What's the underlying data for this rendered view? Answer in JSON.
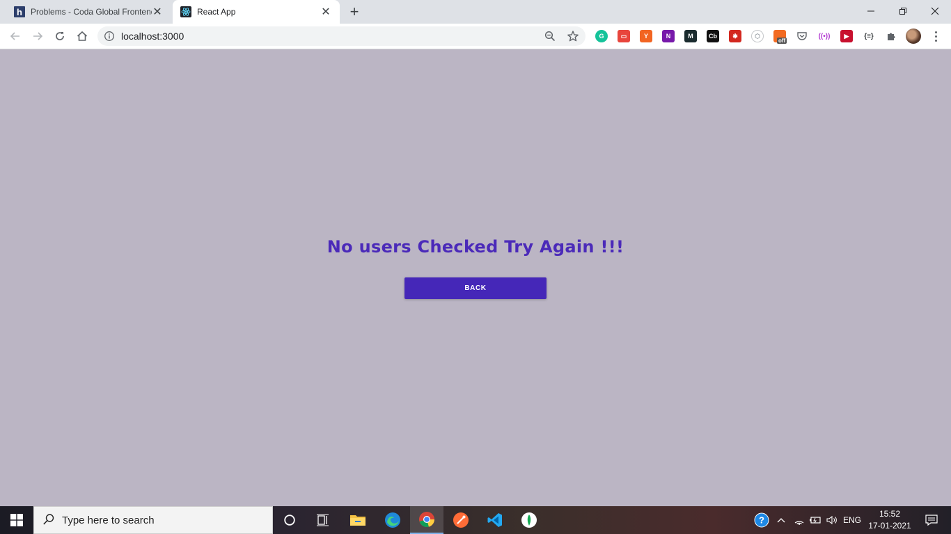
{
  "tabs": [
    {
      "title": "Problems - Coda Global Frontend",
      "favicon": "hackerearth-h-icon"
    },
    {
      "title": "React App",
      "favicon": "react-atom-icon"
    }
  ],
  "omnibox": {
    "url": "localhost:3000"
  },
  "extensions": [
    "grammarly",
    "ext-red",
    "ext-orange",
    "onenote",
    "medium-m",
    "cb",
    "ext-red-2",
    "ext-hex",
    "ext-off",
    "pocket",
    "ext-radio",
    "ext-play",
    "json-viewer",
    "puzzle"
  ],
  "extension_badge": "off",
  "page": {
    "message": "No users Checked Try Again !!!",
    "back_label": "BACK"
  },
  "taskbar": {
    "search_placeholder": "Type here to search",
    "language": "ENG",
    "time": "15:52",
    "date": "17-01-2021"
  },
  "colors": {
    "page_background": "#bbb5c4",
    "accent": "#4527b8",
    "message_text": "#4b2ab9"
  }
}
